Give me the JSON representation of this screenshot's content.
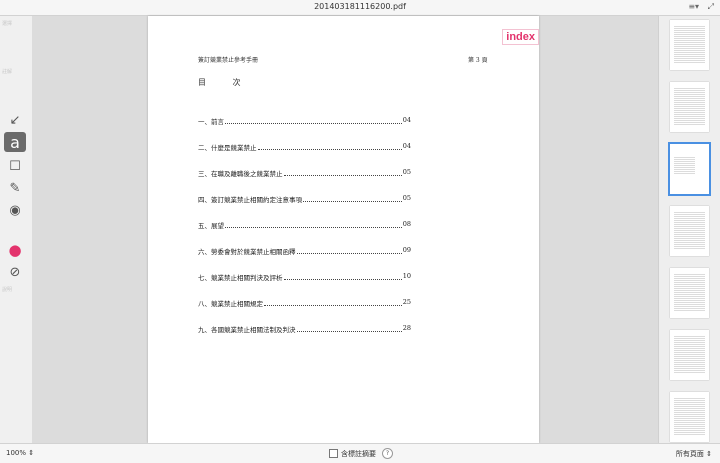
{
  "window": {
    "title": "201403181116200.pdf",
    "list_icon": "≡▾",
    "fullscreen_icon": "⤢"
  },
  "ghost_text": [
    "選擇",
    "註解",
    "說明"
  ],
  "toolbar": {
    "arrow": "↙",
    "text_tool": "a",
    "rect": "☐",
    "pen": "✎",
    "eye": "◉",
    "color": "●",
    "stroke": "⊘"
  },
  "page": {
    "index_tag": "index",
    "header": "簽訂競業禁止參考手冊",
    "page_number": "第 3 頁",
    "toc_title": "目 次",
    "toc": [
      {
        "label": "一、前言",
        "page": "04"
      },
      {
        "label": "二、什麼是競業禁止",
        "page": "04"
      },
      {
        "label": "三、在職及離職後之競業禁止",
        "page": "05"
      },
      {
        "label": "四、簽訂競業禁止相關約定注意事項",
        "page": "05"
      },
      {
        "label": "五、展望",
        "page": "08"
      },
      {
        "label": "六、勞委會對於競業禁止相關函釋",
        "page": "09"
      },
      {
        "label": "七、競業禁止相關判決及評析",
        "page": "10"
      },
      {
        "label": "八、競業禁止相關規定",
        "page": "25"
      },
      {
        "label": "九、各國競業禁止相關法制及判決",
        "page": "28"
      }
    ]
  },
  "thumbnails": {
    "count": 7,
    "selected": 3
  },
  "bottom": {
    "zoom": "100%",
    "include_comments_label": "含標註摘要",
    "help": "?",
    "pages_label": "所有頁面"
  }
}
